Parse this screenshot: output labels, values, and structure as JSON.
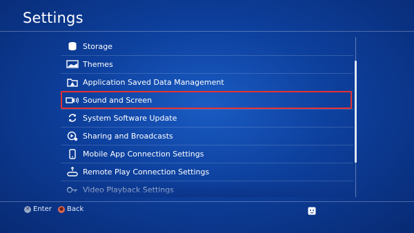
{
  "screen": {
    "title": "Settings"
  },
  "menu": {
    "items": [
      {
        "label": "Storage",
        "icon": "storage-icon"
      },
      {
        "label": "Themes",
        "icon": "themes-icon"
      },
      {
        "label": "Application Saved Data Management",
        "icon": "saved-data-icon"
      },
      {
        "label": "Sound and Screen",
        "icon": "sound-screen-icon",
        "selected": true
      },
      {
        "label": "System Software Update",
        "icon": "update-icon"
      },
      {
        "label": "Sharing and Broadcasts",
        "icon": "sharing-icon"
      },
      {
        "label": "Mobile App Connection Settings",
        "icon": "mobile-icon"
      },
      {
        "label": "Remote Play Connection Settings",
        "icon": "remote-play-icon"
      },
      {
        "label": "Video Playback Settings",
        "icon": "video-playback-icon"
      }
    ]
  },
  "footer": {
    "enter_label": "Enter",
    "back_label": "Back",
    "enter_glyph": "✕",
    "back_glyph": "●"
  },
  "colors": {
    "background": "#0d3f9c",
    "selection": "#e8312f",
    "text": "#ffffff"
  }
}
